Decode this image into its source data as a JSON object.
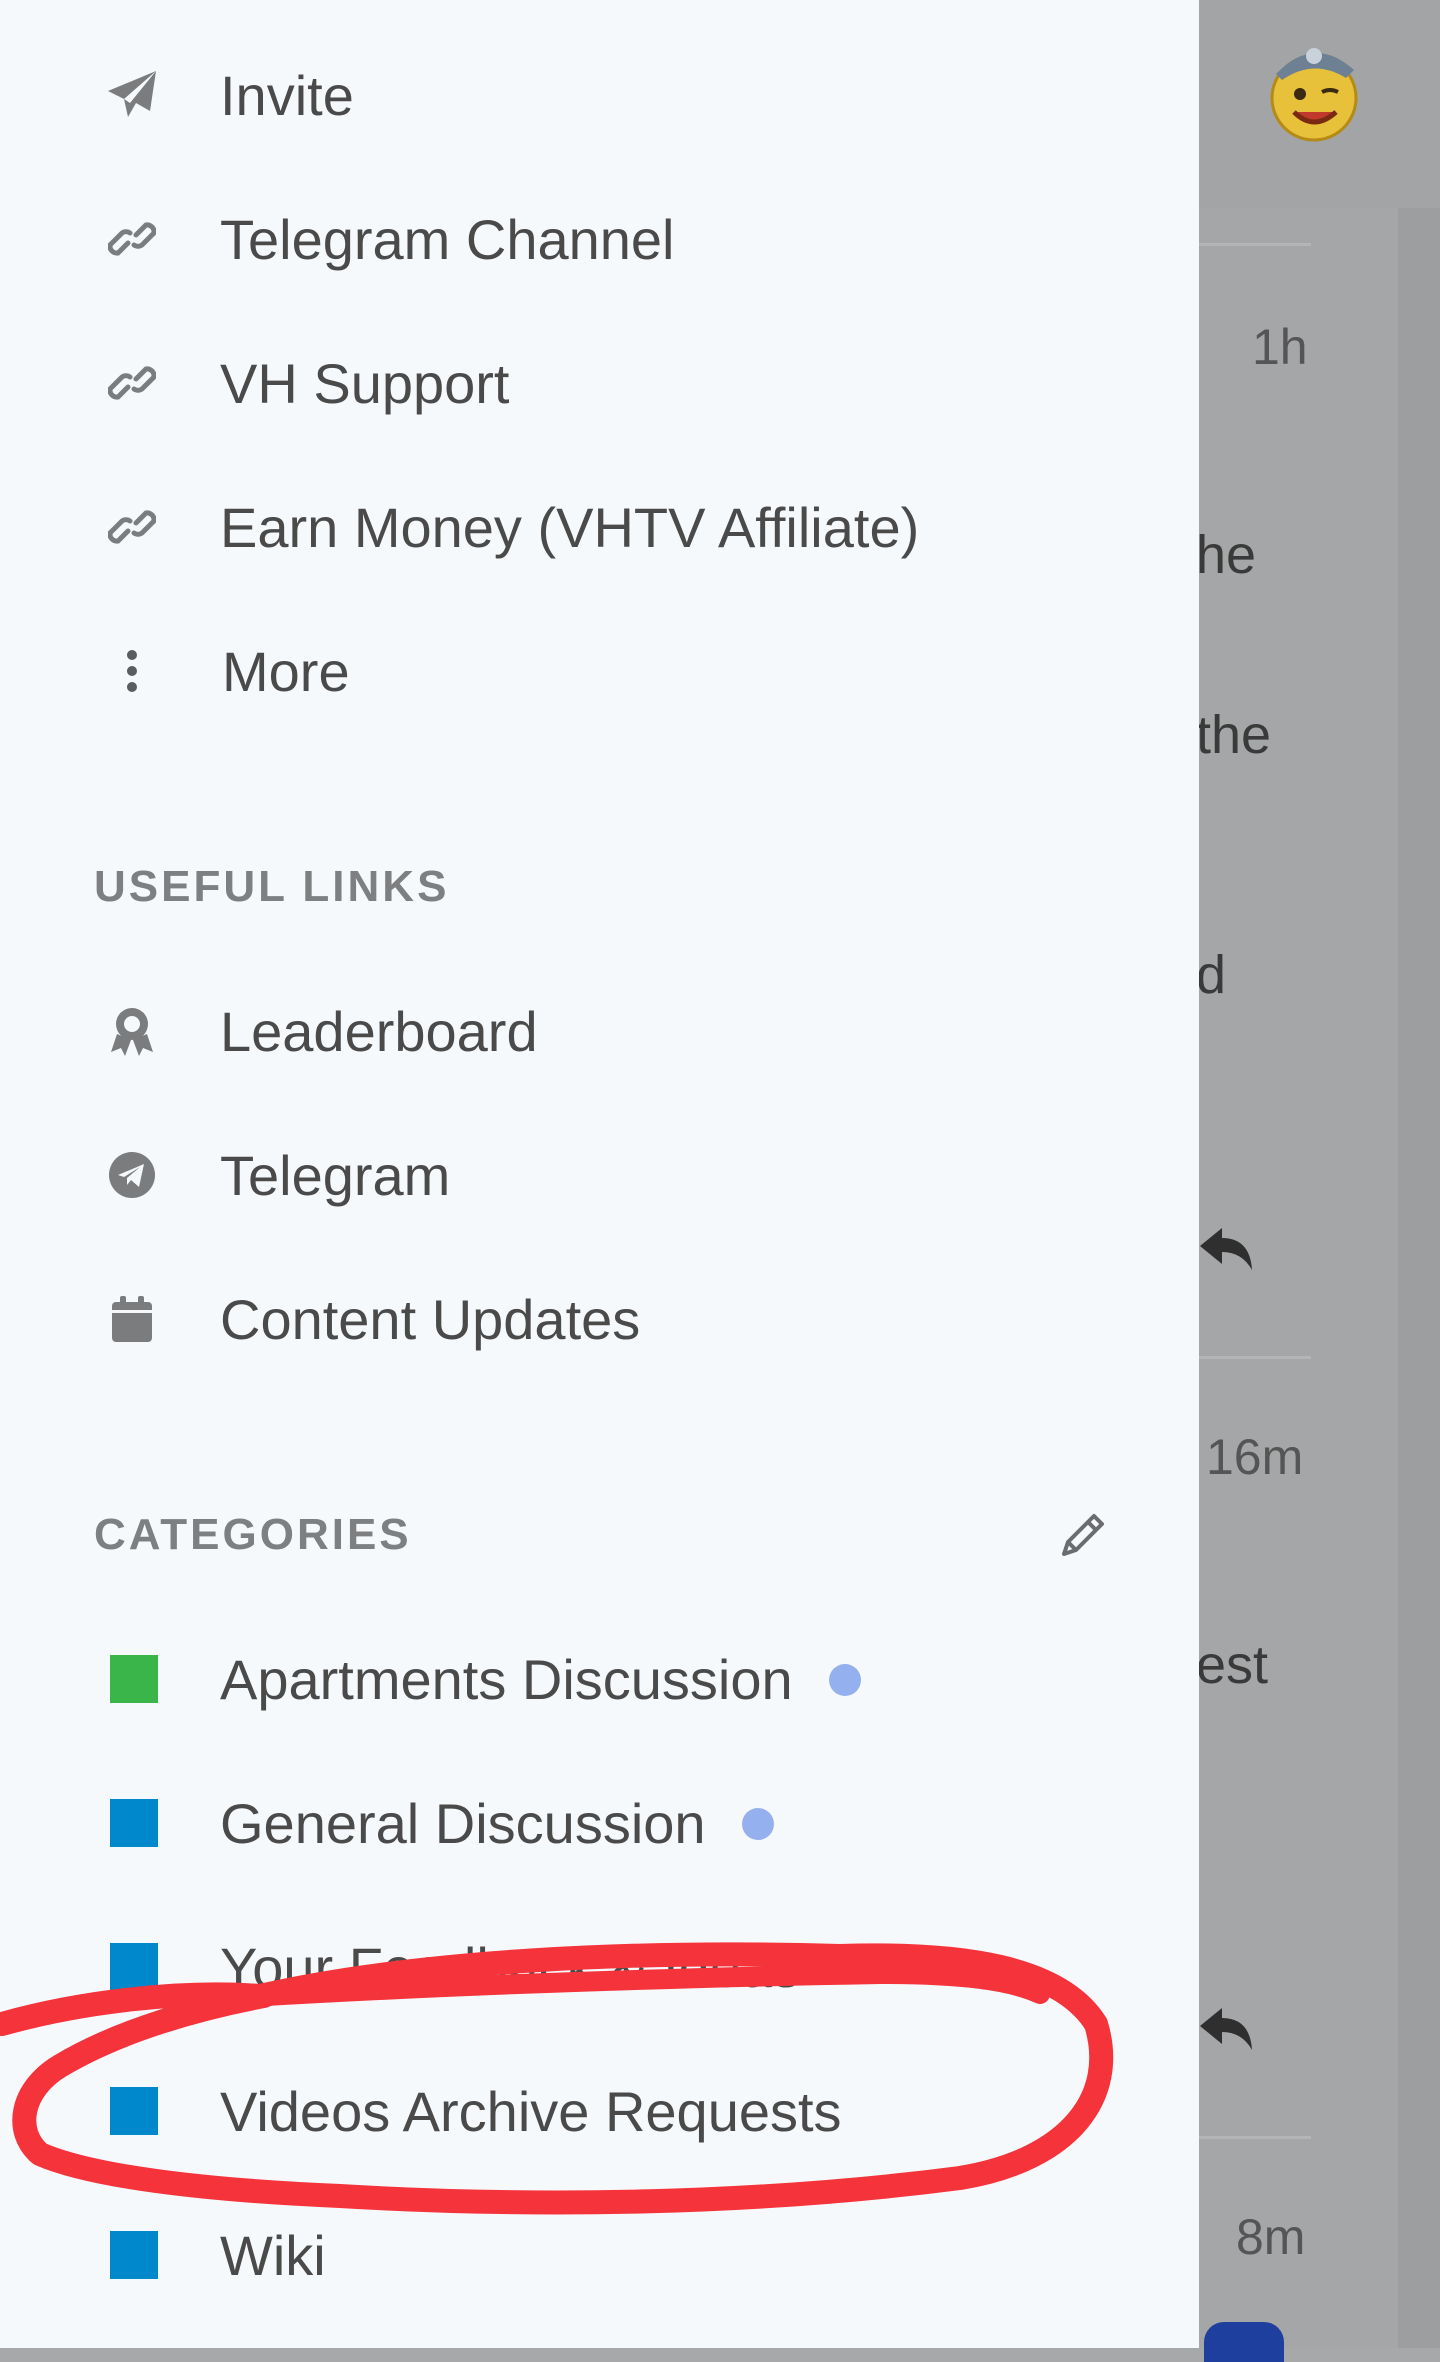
{
  "background": {
    "times": [
      "1h",
      "16m",
      "8m"
    ],
    "text_fragments": [
      "he",
      "the",
      "d",
      "est"
    ]
  },
  "drawer": {
    "top_items": [
      {
        "label": "Invite",
        "icon": "paper-plane-icon"
      },
      {
        "label": "Telegram Channel",
        "icon": "link-icon"
      },
      {
        "label": "VH Support",
        "icon": "link-icon"
      },
      {
        "label": "Earn Money (VHTV Affiliate)",
        "icon": "link-icon"
      },
      {
        "label": "More",
        "icon": "vertical-ellipsis-icon"
      }
    ],
    "useful_links": {
      "title": "USEFUL LINKS",
      "items": [
        {
          "label": "Leaderboard",
          "icon": "award-icon"
        },
        {
          "label": "Telegram",
          "icon": "telegram-icon"
        },
        {
          "label": "Content Updates",
          "icon": "calendar-icon"
        }
      ]
    },
    "categories": {
      "title": "CATEGORIES",
      "edit_icon": "pencil-icon",
      "items": [
        {
          "label": "Apartments Discussion",
          "color": "#3ab54a",
          "unread": true
        },
        {
          "label": "General Discussion",
          "color": "#0088cc",
          "unread": true
        },
        {
          "label": "Your Feedback & Ideas",
          "color": "#0088cc",
          "unread": false
        },
        {
          "label": "Videos Archive Requests",
          "color": "#0088cc",
          "unread": false
        },
        {
          "label": "Wiki",
          "color": "#0088cc",
          "unread": false
        }
      ]
    }
  },
  "colors": {
    "annotation": "#f5333b",
    "unread_dot": "#95b0ef"
  }
}
